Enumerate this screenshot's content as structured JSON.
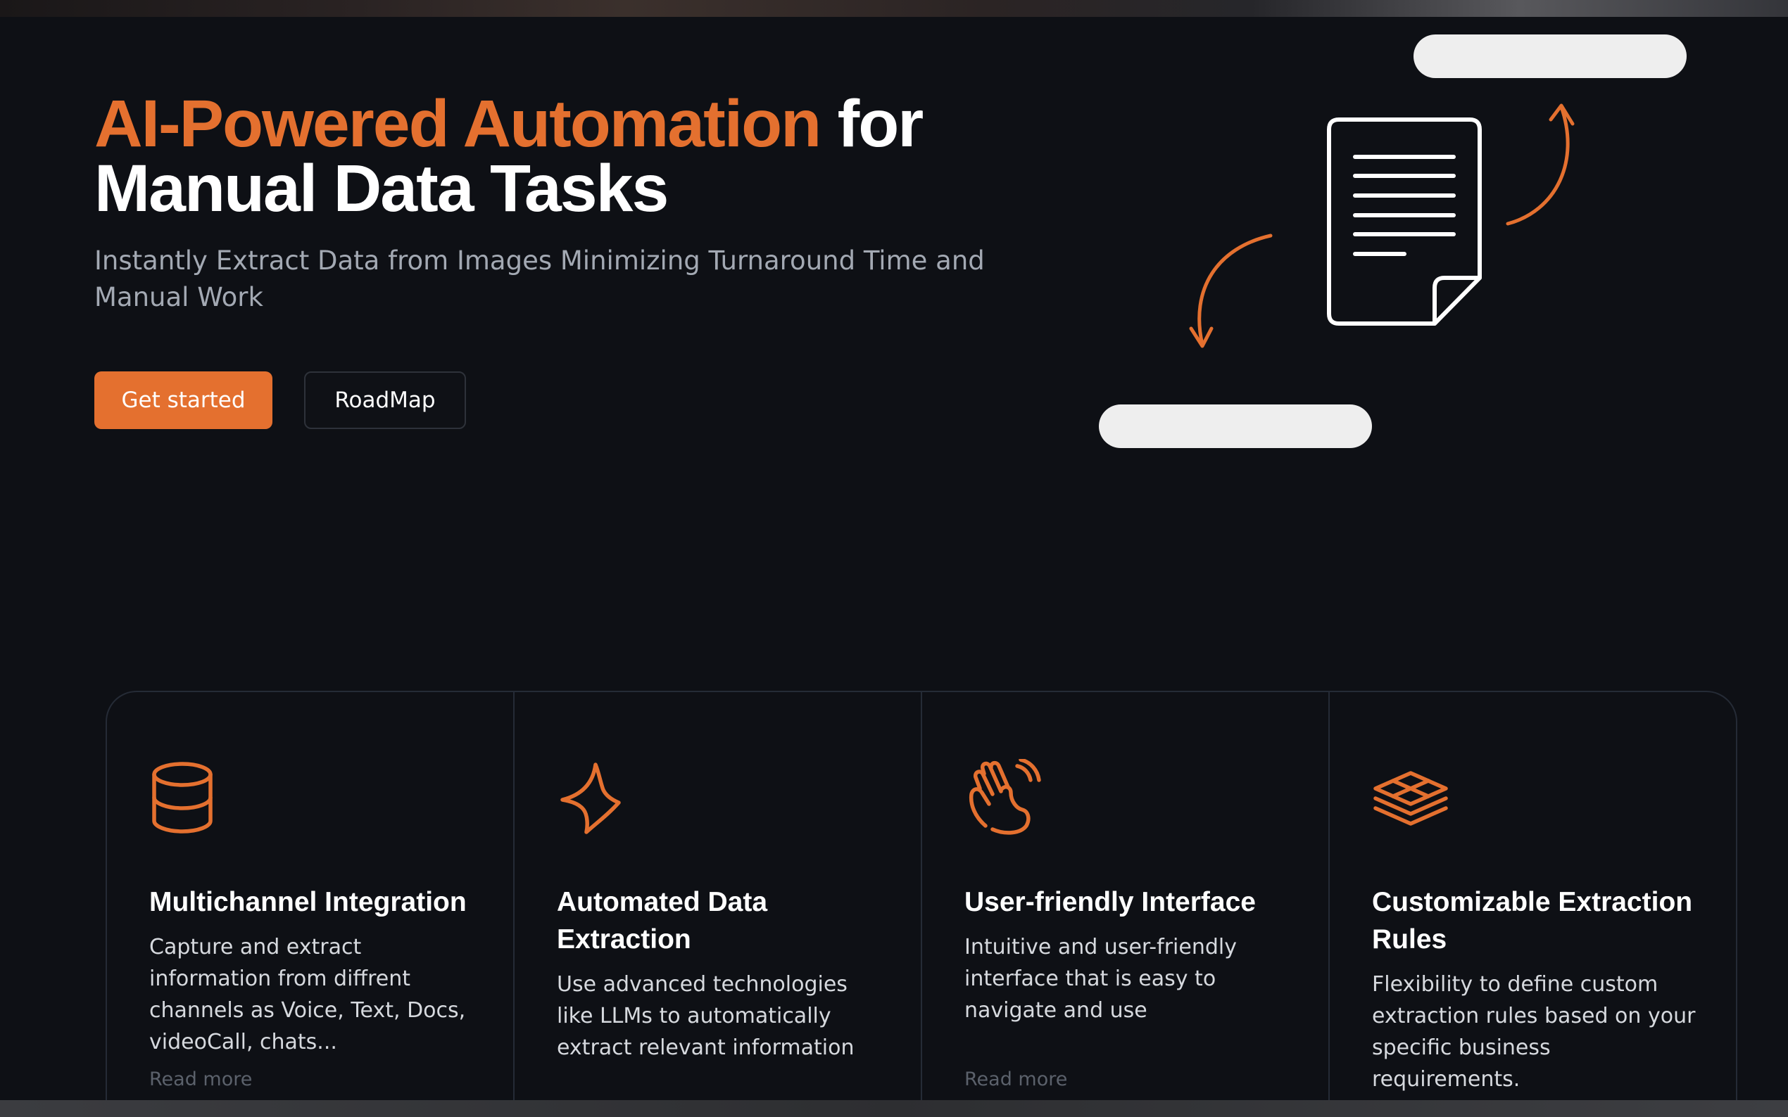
{
  "hero": {
    "title_accent": "AI-Powered Automation",
    "title_rest_1": "for",
    "title_rest_2": "Manual Data Tasks",
    "subtitle": "Instantly Extract Data from Images Minimizing Turnaround Time and Manual Work",
    "primary_button": "Get started",
    "secondary_button": "RoadMap"
  },
  "illustration": {
    "icon": "document-icon",
    "arrows": [
      "curved-arrow-up-icon",
      "curved-arrow-down-icon"
    ]
  },
  "features": [
    {
      "icon": "database-icon",
      "title": "Multichannel Integration",
      "description": "Capture and extract information from diffrent channels as Voice, Text, Docs, videoCall, chats...",
      "link": "Read more"
    },
    {
      "icon": "lightning-icon",
      "title": "Automated Data Extraction",
      "description": "Use advanced technologies like LLMs to automatically extract relevant information",
      "link": ""
    },
    {
      "icon": "hand-wave-icon",
      "title": "User-friendly Interface",
      "description": "Intuitive and user-friendly interface that is easy to navigate and use",
      "link": "Read more"
    },
    {
      "icon": "layers-icon",
      "title": "Customizable Extraction Rules",
      "description": "Flexibility to define custom extraction rules based on your specific business requirements.",
      "link": ""
    }
  ],
  "colors": {
    "accent": "#e4702f",
    "background": "#0e1015",
    "border": "#252b36",
    "muted_text": "#a3a9b3"
  }
}
